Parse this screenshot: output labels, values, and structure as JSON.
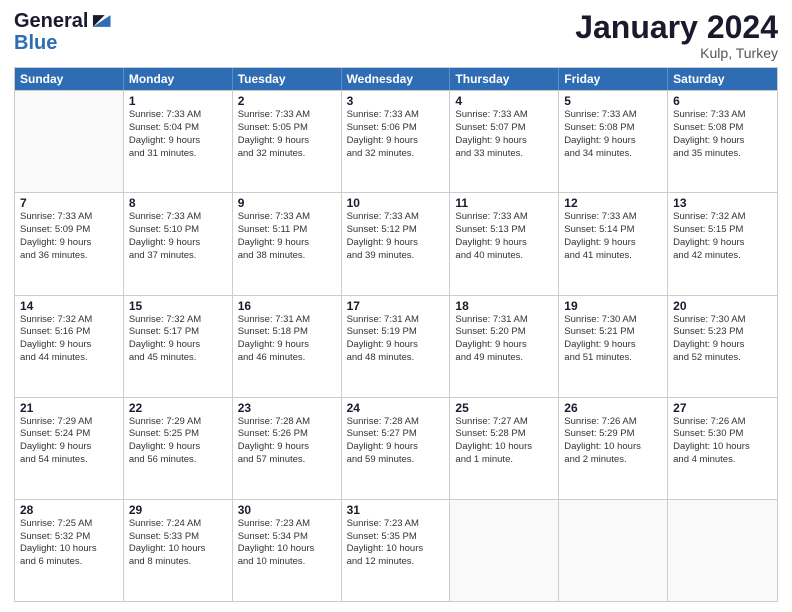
{
  "header": {
    "logo_line1": "General",
    "logo_line2": "Blue",
    "month_title": "January 2024",
    "location": "Kulp, Turkey"
  },
  "weekdays": [
    "Sunday",
    "Monday",
    "Tuesday",
    "Wednesday",
    "Thursday",
    "Friday",
    "Saturday"
  ],
  "weeks": [
    [
      {
        "day": "",
        "info": ""
      },
      {
        "day": "1",
        "info": "Sunrise: 7:33 AM\nSunset: 5:04 PM\nDaylight: 9 hours\nand 31 minutes."
      },
      {
        "day": "2",
        "info": "Sunrise: 7:33 AM\nSunset: 5:05 PM\nDaylight: 9 hours\nand 32 minutes."
      },
      {
        "day": "3",
        "info": "Sunrise: 7:33 AM\nSunset: 5:06 PM\nDaylight: 9 hours\nand 32 minutes."
      },
      {
        "day": "4",
        "info": "Sunrise: 7:33 AM\nSunset: 5:07 PM\nDaylight: 9 hours\nand 33 minutes."
      },
      {
        "day": "5",
        "info": "Sunrise: 7:33 AM\nSunset: 5:08 PM\nDaylight: 9 hours\nand 34 minutes."
      },
      {
        "day": "6",
        "info": "Sunrise: 7:33 AM\nSunset: 5:08 PM\nDaylight: 9 hours\nand 35 minutes."
      }
    ],
    [
      {
        "day": "7",
        "info": "Sunrise: 7:33 AM\nSunset: 5:09 PM\nDaylight: 9 hours\nand 36 minutes."
      },
      {
        "day": "8",
        "info": "Sunrise: 7:33 AM\nSunset: 5:10 PM\nDaylight: 9 hours\nand 37 minutes."
      },
      {
        "day": "9",
        "info": "Sunrise: 7:33 AM\nSunset: 5:11 PM\nDaylight: 9 hours\nand 38 minutes."
      },
      {
        "day": "10",
        "info": "Sunrise: 7:33 AM\nSunset: 5:12 PM\nDaylight: 9 hours\nand 39 minutes."
      },
      {
        "day": "11",
        "info": "Sunrise: 7:33 AM\nSunset: 5:13 PM\nDaylight: 9 hours\nand 40 minutes."
      },
      {
        "day": "12",
        "info": "Sunrise: 7:33 AM\nSunset: 5:14 PM\nDaylight: 9 hours\nand 41 minutes."
      },
      {
        "day": "13",
        "info": "Sunrise: 7:32 AM\nSunset: 5:15 PM\nDaylight: 9 hours\nand 42 minutes."
      }
    ],
    [
      {
        "day": "14",
        "info": "Sunrise: 7:32 AM\nSunset: 5:16 PM\nDaylight: 9 hours\nand 44 minutes."
      },
      {
        "day": "15",
        "info": "Sunrise: 7:32 AM\nSunset: 5:17 PM\nDaylight: 9 hours\nand 45 minutes."
      },
      {
        "day": "16",
        "info": "Sunrise: 7:31 AM\nSunset: 5:18 PM\nDaylight: 9 hours\nand 46 minutes."
      },
      {
        "day": "17",
        "info": "Sunrise: 7:31 AM\nSunset: 5:19 PM\nDaylight: 9 hours\nand 48 minutes."
      },
      {
        "day": "18",
        "info": "Sunrise: 7:31 AM\nSunset: 5:20 PM\nDaylight: 9 hours\nand 49 minutes."
      },
      {
        "day": "19",
        "info": "Sunrise: 7:30 AM\nSunset: 5:21 PM\nDaylight: 9 hours\nand 51 minutes."
      },
      {
        "day": "20",
        "info": "Sunrise: 7:30 AM\nSunset: 5:23 PM\nDaylight: 9 hours\nand 52 minutes."
      }
    ],
    [
      {
        "day": "21",
        "info": "Sunrise: 7:29 AM\nSunset: 5:24 PM\nDaylight: 9 hours\nand 54 minutes."
      },
      {
        "day": "22",
        "info": "Sunrise: 7:29 AM\nSunset: 5:25 PM\nDaylight: 9 hours\nand 56 minutes."
      },
      {
        "day": "23",
        "info": "Sunrise: 7:28 AM\nSunset: 5:26 PM\nDaylight: 9 hours\nand 57 minutes."
      },
      {
        "day": "24",
        "info": "Sunrise: 7:28 AM\nSunset: 5:27 PM\nDaylight: 9 hours\nand 59 minutes."
      },
      {
        "day": "25",
        "info": "Sunrise: 7:27 AM\nSunset: 5:28 PM\nDaylight: 10 hours\nand 1 minute."
      },
      {
        "day": "26",
        "info": "Sunrise: 7:26 AM\nSunset: 5:29 PM\nDaylight: 10 hours\nand 2 minutes."
      },
      {
        "day": "27",
        "info": "Sunrise: 7:26 AM\nSunset: 5:30 PM\nDaylight: 10 hours\nand 4 minutes."
      }
    ],
    [
      {
        "day": "28",
        "info": "Sunrise: 7:25 AM\nSunset: 5:32 PM\nDaylight: 10 hours\nand 6 minutes."
      },
      {
        "day": "29",
        "info": "Sunrise: 7:24 AM\nSunset: 5:33 PM\nDaylight: 10 hours\nand 8 minutes."
      },
      {
        "day": "30",
        "info": "Sunrise: 7:23 AM\nSunset: 5:34 PM\nDaylight: 10 hours\nand 10 minutes."
      },
      {
        "day": "31",
        "info": "Sunrise: 7:23 AM\nSunset: 5:35 PM\nDaylight: 10 hours\nand 12 minutes."
      },
      {
        "day": "",
        "info": ""
      },
      {
        "day": "",
        "info": ""
      },
      {
        "day": "",
        "info": ""
      }
    ]
  ]
}
